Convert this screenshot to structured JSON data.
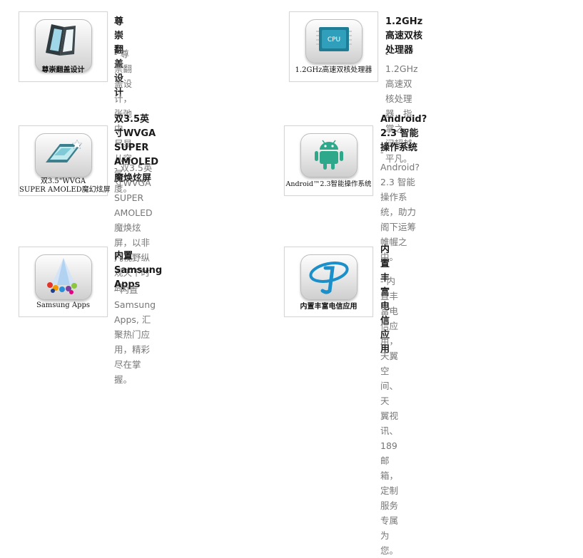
{
  "features": [
    {
      "icon": "flip-phone-icon",
      "caption_lines": [
        "尊崇翻盖设计"
      ],
      "title_lines": [
        "尊崇翻盖设计"
      ],
      "desc_lines": [
        "- 尊崇翻盖设计，张弛中，尽显从容",
        "气度。"
      ]
    },
    {
      "icon": "cpu-chip-icon",
      "chip_label": "CPU",
      "caption_lines": [
        "1.2GHz高速双核处理器"
      ],
      "title_lines": [
        "1.2GHz高速双核处理器"
      ],
      "desc_lines": [
        "- 1.2GHz高速双核处理器，指掌之",
        "间超越平凡。"
      ]
    },
    {
      "icon": "amoled-screen-icon",
      "caption_lines": [
        "双3.5\"WVGA",
        "SUPER AMOLED魔幻炫屏"
      ],
      "title_lines": [
        "双3.5英寸WVGA SUPER AMOLED",
        "魔焕炫屏"
      ],
      "desc_lines": [
        "- 双3.5英寸WVGA SUPER",
        "AMOLED魔焕炫屏，以非凡视野纵",
        "观天下时局。"
      ]
    },
    {
      "icon": "android-robot-icon",
      "caption_lines": [
        "Android™2.3智能操作系统"
      ],
      "title_lines": [
        "Android? 2.3 智能操作系统"
      ],
      "desc_lines": [
        "- Android? 2.3 智能操作系统，助力",
        "阁下运筹帷幄之中。"
      ]
    },
    {
      "icon": "samsung-apps-icon",
      "caption_lines": [
        "Samsung Apps"
      ],
      "title_lines": [
        "内置Samsung Apps"
      ],
      "desc_lines": [
        "- 内置Samsung Apps, 汇聚热门应",
        "用，精彩尽在掌握。"
      ]
    },
    {
      "icon": "china-telecom-icon",
      "caption_lines": [
        "内置丰富电信应用"
      ],
      "title_lines": [
        "内置丰富电信应用"
      ],
      "desc_lines": [
        "- 内置丰富电信应用，天翼空间、天",
        "翼视讯、189邮箱，定制服务专属为",
        "您。"
      ]
    }
  ]
}
